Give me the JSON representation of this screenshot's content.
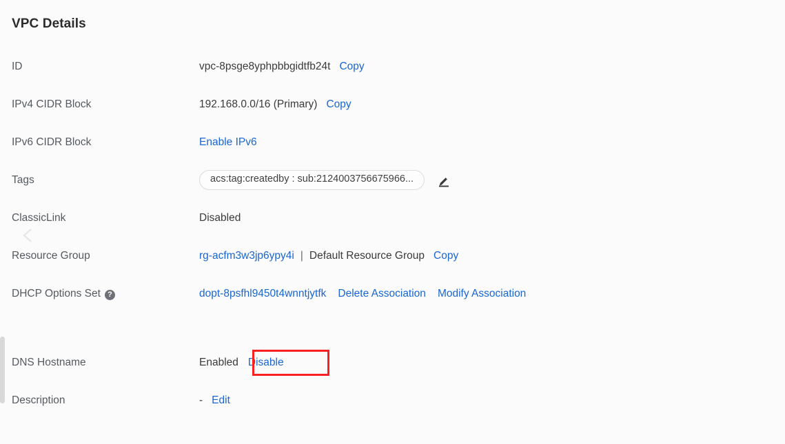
{
  "page": {
    "title": "VPC Details"
  },
  "icons": {
    "help": "?",
    "edit_pencil": "edit-pencil-icon",
    "collapse_chevron": "chevron-left-icon"
  },
  "details": {
    "id": {
      "label": "ID",
      "value": "vpc-8psge8yphpbbgidtfb24t",
      "copy_label": "Copy"
    },
    "ipv4_cidr": {
      "label": "IPv4 CIDR Block",
      "value": "192.168.0.0/16 (Primary)",
      "copy_label": "Copy"
    },
    "ipv6_cidr": {
      "label": "IPv6 CIDR Block",
      "enable_link": "Enable IPv6"
    },
    "tags": {
      "label": "Tags",
      "chip": "acs:tag:createdby : sub:2124003756675966..."
    },
    "classiclink": {
      "label": "ClassicLink",
      "value": "Disabled"
    },
    "resource_group": {
      "label": "Resource Group",
      "id_link": "rg-acfm3w3jp6ypy4i",
      "separator": "|",
      "name": "Default Resource Group",
      "copy_label": "Copy"
    },
    "dhcp_options_set": {
      "label": "DHCP Options Set",
      "id_link": "dopt-8psfhl9450t4wnntjytfk",
      "delete_label": "Delete Association",
      "modify_label": "Modify Association"
    },
    "dns_hostname": {
      "label": "DNS Hostname",
      "value": "Enabled",
      "action_label": "Disable"
    },
    "description": {
      "label": "Description",
      "value": "-",
      "edit_label": "Edit"
    }
  },
  "colors": {
    "link": "#1966d2",
    "highlight": "#fb2020",
    "label_text": "#555a60",
    "value_text": "#333333",
    "background": "#fbfbfb"
  }
}
